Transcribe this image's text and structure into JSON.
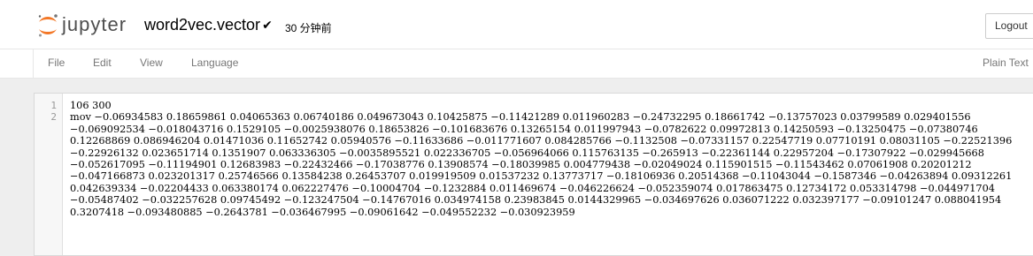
{
  "header": {
    "logo_text": "jupyter",
    "notebook_name": "word2vec.vector",
    "save_time": "30 分钟前",
    "logout_label": "Logout"
  },
  "menubar": {
    "items": [
      "File",
      "Edit",
      "View",
      "Language"
    ],
    "mode_label": "Plain Text"
  },
  "editor": {
    "line_numbers": [
      "1",
      "2"
    ],
    "lines": [
      "106 300",
      "mov −0.06934583 0.18659861 0.04065363 0.06740186 0.049673043 0.10425875 −0.11421289 0.011960283 −0.24732295 0.18661742 −0.13757023 0.03799589 0.029401556 −0.069092534 −0.018043716 0.1529105 −0.0025938076 0.18653826 −0.101683676 0.13265154 0.011997943 −0.0782622 0.09972813 0.14250593 −0.13250475 −0.07380746 0.12268869 0.086946204 0.01471036 0.11652742 0.05940576 −0.11633686 −0.011771607 0.084285766 −0.1132508 −0.07331157 0.22547719 0.07710191 0.08031105 −0.22521396 −0.22926132 0.023651714 0.1351907 0.063336305 −0.0035895521 0.022336705 −0.056964066 0.115763135 −0.265913 −0.22361144 0.22957204 −0.17307922 −0.029945668 −0.052617095 −0.11194901 0.12683983 −0.22432466 −0.17038776 0.13908574 −0.18039985 0.004779438 −0.02049024 0.115901515 −0.11543462 0.07061908 0.20201212 −0.047166873 0.023201317 0.25746566 0.13584238 0.26453707 0.019919509 0.01537232 0.13773717 −0.18106936 0.20514368 −0.11043044 −0.1587346 −0.04263894 0.09312261 0.042639334 −0.02204433 0.063380174 0.062227476 −0.10004704 −0.1232884 0.011469674 −0.046226624 −0.052359074 0.017863475 0.12734172 0.053314798 −0.044971704 −0.05487402 −0.032257628 0.09745492 −0.123247504 −0.14767016 0.034974158 0.23983845 0.0144329965 −0.034697626 0.036071222 0.032397177 −0.09101247 0.088041954 0.3207418 −0.093480885 −0.2643781 −0.036467995 −0.09061642 −0.049552232 −0.030923959"
    ]
  }
}
